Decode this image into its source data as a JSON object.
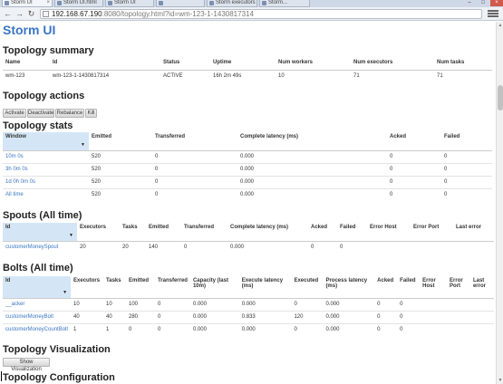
{
  "browser": {
    "tabs": [
      {
        "label": "Storm UI"
      },
      {
        "label": "Storm UI.html"
      },
      {
        "label": "Storm UI"
      },
      {
        "label": ""
      },
      {
        "label": "Storm executors"
      },
      {
        "label": "Storm..."
      }
    ],
    "url_host": "192.168.67.190",
    "url_rest": ":8080/topology.html?id=wm-123-1-1430817314"
  },
  "app": {
    "title": "Storm UI"
  },
  "summary": {
    "heading": "Topology summary",
    "headers": [
      "Name",
      "Id",
      "Status",
      "Uptime",
      "Num workers",
      "Num executors",
      "Num tasks"
    ],
    "row": [
      "wm-123",
      "wm-123-1-1430817314",
      "ACTIVE",
      "16h 2m 49s",
      "10",
      "71",
      "71"
    ]
  },
  "actions": {
    "heading": "Topology actions",
    "buttons": [
      "Activate",
      "Deactivate",
      "Rebalance",
      "Kill"
    ]
  },
  "stats": {
    "heading": "Topology stats",
    "headers": [
      "Window",
      "Emitted",
      "Transferred",
      "Complete latency (ms)",
      "Acked",
      "Failed"
    ],
    "rows": [
      [
        "10m 0s",
        "520",
        "0",
        "0.000",
        "0",
        "0"
      ],
      [
        "3h 0m 0s",
        "520",
        "0",
        "0.000",
        "0",
        "0"
      ],
      [
        "1d 0h 0m 0s",
        "520",
        "0",
        "0.000",
        "0",
        "0"
      ],
      [
        "All time",
        "520",
        "0",
        "0.000",
        "0",
        "0"
      ]
    ]
  },
  "spouts": {
    "heading": "Spouts (All time)",
    "headers": [
      "Id",
      "Executors",
      "Tasks",
      "Emitted",
      "Transferred",
      "Complete latency (ms)",
      "Acked",
      "Failed",
      "Error Host",
      "Error Port",
      "Last error"
    ],
    "rows": [
      [
        "customerMoneySpout",
        "20",
        "20",
        "140",
        "0",
        "0.000",
        "0",
        "0",
        "",
        "",
        ""
      ]
    ]
  },
  "bolts": {
    "heading": "Bolts (All time)",
    "headers": [
      "Id",
      "Executors",
      "Tasks",
      "Emitted",
      "Transferred",
      "Capacity (last 10m)",
      "Execute latency (ms)",
      "Executed",
      "Process latency (ms)",
      "Acked",
      "Failed",
      "Error Host",
      "Error Port",
      "Last error"
    ],
    "rows": [
      [
        "__acker",
        "10",
        "10",
        "100",
        "0",
        "0.000",
        "0.000",
        "0",
        "0.000",
        "0",
        "0",
        "",
        "",
        ""
      ],
      [
        "customerMoneyBolt",
        "40",
        "40",
        "280",
        "0",
        "0.000",
        "0.833",
        "120",
        "0.000",
        "0",
        "0",
        "",
        "",
        ""
      ],
      [
        "customerMoneyCountBolt",
        "1",
        "1",
        "0",
        "0",
        "0.000",
        "0.000",
        "0",
        "0.000",
        "0",
        "0",
        "",
        "",
        ""
      ]
    ]
  },
  "visualization": {
    "heading": "Topology Visualization",
    "button": "Show Visualization"
  },
  "configuration": {
    "heading": "Topology Configuration"
  }
}
